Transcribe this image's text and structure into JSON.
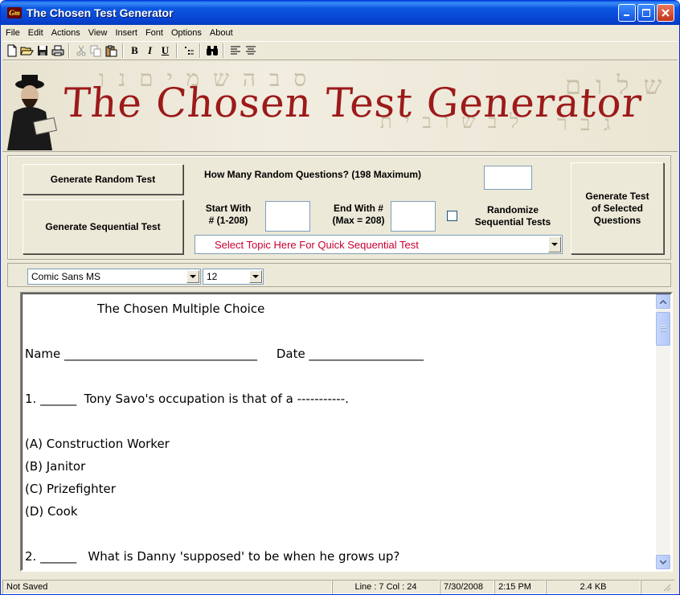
{
  "window": {
    "title": "The Chosen Test Generator",
    "app_icon_text": "Gm"
  },
  "menu": [
    {
      "label": "File"
    },
    {
      "label": "Edit"
    },
    {
      "label": "Actions"
    },
    {
      "label": "View"
    },
    {
      "label": "Insert"
    },
    {
      "label": "Font"
    },
    {
      "label": "Options"
    },
    {
      "label": "About"
    }
  ],
  "toolbar": {
    "new": "🗋",
    "open": "📂",
    "save": "💾",
    "print": "🖶",
    "cut": "✂",
    "copy": "⧉",
    "paste": "📋",
    "bold": "B",
    "italic": "I",
    "underline": "U",
    "bullets": "⁝",
    "find": "🔍",
    "align_left": "☰",
    "justify": "☰"
  },
  "banner": {
    "title": "The Chosen Test Generator"
  },
  "controls": {
    "generate_random": "Generate Random Test",
    "generate_sequential": "Generate Sequential Test",
    "how_many_label": "How Many Random Questions? (198 Maximum)",
    "how_many_value": "",
    "start_with_label_1": "Start With",
    "start_with_label_2": "# (1-208)",
    "start_value": "",
    "end_with_label_1": "End With #",
    "end_with_label_2": "(Max = 208)",
    "end_value": "",
    "randomize_label_1": "Randomize",
    "randomize_label_2": "Sequential Tests",
    "generate_selected_1": "Generate Test",
    "generate_selected_2": "of Selected",
    "generate_selected_3": "Questions",
    "topic_select": "Select Topic Here For Quick Sequential Test"
  },
  "font": {
    "family": "Comic Sans MS",
    "size": "12"
  },
  "document": {
    "lines": [
      "The Chosen Multiple Choice",
      "Name ________________________________     Date ___________________",
      "1. ______  Tony Savo's occupation is that of a -----------.",
      "(A) Construction Worker",
      "(B) Janitor",
      "(C) Prizefighter",
      "(D) Cook",
      "2. ______   What is Danny 'supposed' to be when he grows up?"
    ]
  },
  "status": {
    "saved": "Not Saved",
    "position": "Line : 7   Col : 24",
    "date": "7/30/2008",
    "time": "2:15 PM",
    "size": "2.4 KB"
  }
}
